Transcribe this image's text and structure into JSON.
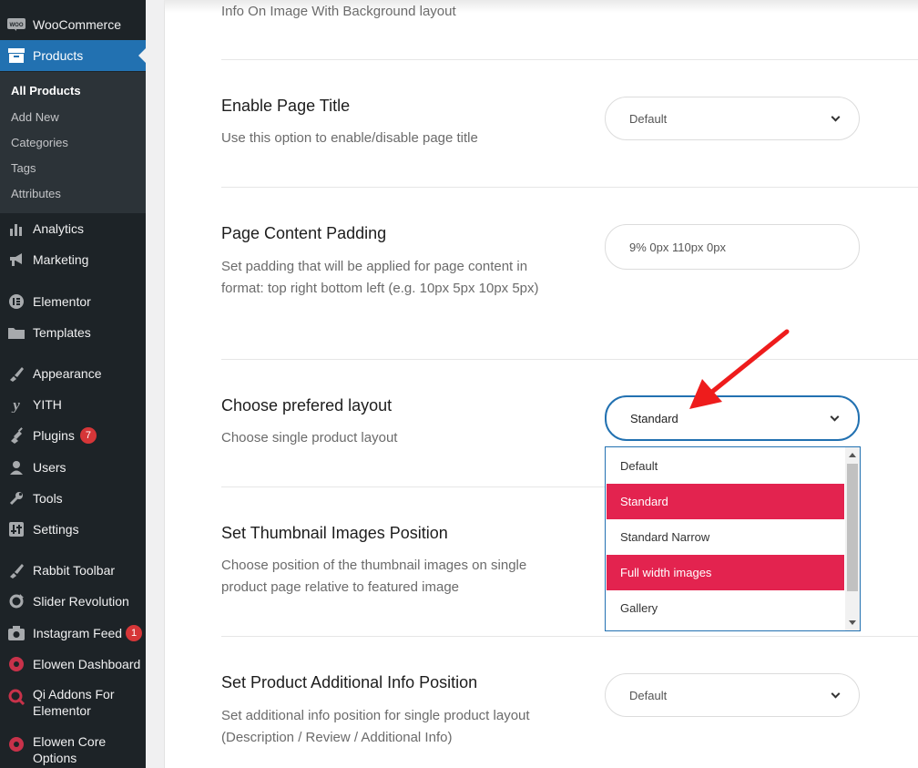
{
  "sidebar": {
    "woocommerce": "WooCommerce",
    "products": "Products",
    "submenu": [
      "All Products",
      "Add New",
      "Categories",
      "Tags",
      "Attributes"
    ],
    "items": [
      {
        "label": "Analytics",
        "icon": "bar-chart-icon"
      },
      {
        "label": "Marketing",
        "icon": "megaphone-icon"
      },
      {
        "label": "Elementor",
        "icon": "elementor-icon"
      },
      {
        "label": "Templates",
        "icon": "folder-icon"
      },
      {
        "label": "Appearance",
        "icon": "brush-icon"
      },
      {
        "label": "YITH",
        "icon": "yith-icon"
      },
      {
        "label": "Plugins",
        "icon": "plugin-icon",
        "badge": "7"
      },
      {
        "label": "Users",
        "icon": "user-icon"
      },
      {
        "label": "Tools",
        "icon": "wrench-icon"
      },
      {
        "label": "Settings",
        "icon": "settings-icon"
      },
      {
        "label": "Rabbit Toolbar",
        "icon": "rabbit-icon"
      },
      {
        "label": "Slider Revolution",
        "icon": "refresh-icon"
      },
      {
        "label": "Instagram Feed",
        "icon": "camera-icon",
        "badge": "1"
      },
      {
        "label": "Elowen Dashboard",
        "icon": "elowen-icon"
      },
      {
        "label": "Qi Addons For Elementor",
        "icon": "qi-icon"
      },
      {
        "label": "Elowen Core Options",
        "icon": "elowen-core-icon"
      }
    ]
  },
  "main": {
    "top_text": "Info On Image With Background layout",
    "fields": [
      {
        "title": "Enable Page Title",
        "desc": "Use this option to enable/disable page title",
        "value": "Default"
      },
      {
        "title": "Page Content Padding",
        "desc": "Set padding that will be applied for page content in format: top right bottom left (e.g. 10px 5px 10px 5px)",
        "value": "9% 0px 110px 0px"
      },
      {
        "title": "Choose prefered layout",
        "desc": "Choose single product layout",
        "value": "Standard"
      },
      {
        "title": "Set Thumbnail Images Position",
        "desc": "Choose position of the thumbnail images on single product page relative to featured image"
      },
      {
        "title": "Set Product Additional Info Position",
        "desc": "Set additional info position for single product layout (Description / Review / Additional Info)",
        "value": "Default"
      }
    ],
    "dropdown_options": [
      "Default",
      "Standard",
      "Standard Narrow",
      "Full width images",
      "Gallery"
    ]
  },
  "colors": {
    "accent": "#2271b1",
    "highlight": "#e3234f",
    "annotation": "#ee1c1c"
  }
}
